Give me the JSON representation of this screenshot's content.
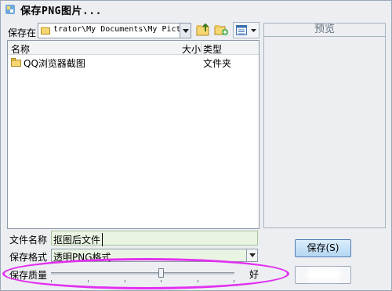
{
  "window": {
    "title": "保存PNG图片..."
  },
  "save_in": {
    "label": "保存在",
    "path": "trator\\My Documents\\My Pictures"
  },
  "file_list": {
    "columns": {
      "name": "名称",
      "size": "大小",
      "type": "类型"
    },
    "rows": [
      {
        "name": "QQ浏览器截图",
        "type": "文件夹"
      }
    ]
  },
  "preview": {
    "title": "预览"
  },
  "filename": {
    "label": "文件名称",
    "value": "抠图后文件"
  },
  "format": {
    "label": "保存格式",
    "value": "透明PNG格式"
  },
  "quality": {
    "label": "保存质量",
    "end_label": "好",
    "level_fraction": 0.6
  },
  "buttons": {
    "save": "保存(S)"
  },
  "colors": {
    "highlight": "#e22ff0",
    "input_bg": "#e9f4e3"
  }
}
